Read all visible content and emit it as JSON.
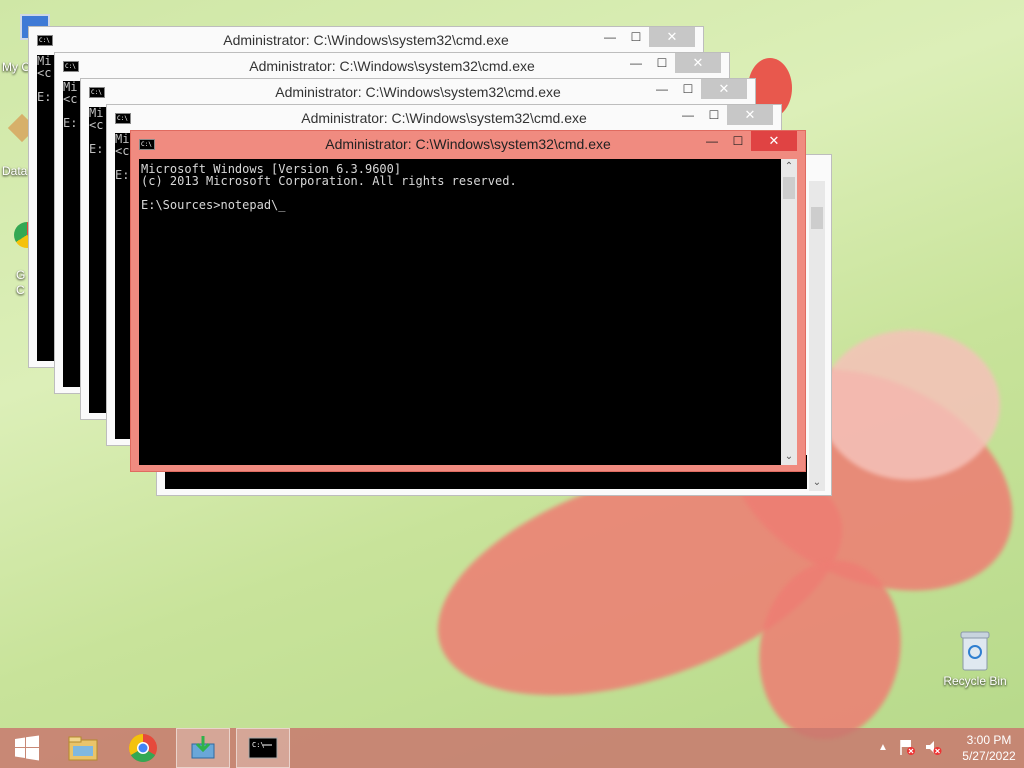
{
  "desktop": {
    "icons": [
      {
        "label": "Recycle Bin"
      }
    ],
    "partial_labels": [
      "My C",
      "Data",
      "G",
      "C"
    ]
  },
  "windows": [
    {
      "title": "Administrator: C:\\Windows\\system32\\cmd.exe",
      "lines": [
        "Mi",
        "<c",
        "",
        "E:"
      ]
    },
    {
      "title": "Administrator: C:\\Windows\\system32\\cmd.exe",
      "lines": [
        "Mi",
        "<c",
        "",
        "E:"
      ]
    },
    {
      "title": "Administrator: C:\\Windows\\system32\\cmd.exe",
      "lines": [
        "Mi",
        "<c",
        "",
        "E:"
      ]
    },
    {
      "title": "Administrator: C:\\Windows\\system32\\cmd.exe",
      "lines": [
        "Mi",
        "<c",
        "",
        "E:"
      ]
    },
    {
      "title": "Administrator: C:\\Windows\\system32\\cmd.exe",
      "lines": [
        "Microsoft Windows [Version 6.3.9600]",
        "(c) 2013 Microsoft Corporation. All rights reserved.",
        "",
        "E:\\Sources>notepad\\_"
      ]
    }
  ],
  "window_controls": {
    "minimize": "—",
    "maximize": "☐",
    "close": "✕"
  },
  "taskbar": {
    "items": [
      {
        "name": "start"
      },
      {
        "name": "file-explorer"
      },
      {
        "name": "chrome"
      },
      {
        "name": "installer"
      },
      {
        "name": "cmd",
        "active": true
      }
    ],
    "tray": {
      "time": "3:00 PM",
      "date": "5/27/2022"
    }
  },
  "colors": {
    "active_frame": "#f08b80",
    "close_active": "#e04343",
    "taskbar": "#c8786e"
  }
}
